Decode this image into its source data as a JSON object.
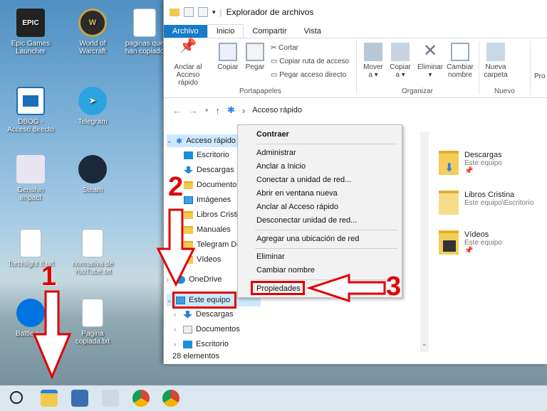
{
  "desktop": {
    "icons": [
      {
        "label": "Epic Games Launcher",
        "badge": "EPIC"
      },
      {
        "label": "World of Warcraft",
        "badge": "W"
      },
      {
        "label": "paginas que han copiado",
        "badge": ""
      },
      {
        "label": "DBOG - Acceso directo",
        "badge": ""
      },
      {
        "label": "Telegram",
        "badge": ""
      },
      {
        "label": "Genshin Impact",
        "badge": ""
      },
      {
        "label": "Steam",
        "badge": ""
      },
      {
        "label": "Torchlight II.url",
        "badge": ""
      },
      {
        "label": "normativa de YouTube.txt",
        "badge": ""
      },
      {
        "label": "Battle.net",
        "badge": ""
      },
      {
        "label": "Pagina copiada.txt",
        "badge": ""
      }
    ]
  },
  "window": {
    "title": "Explorador de archivos",
    "tabs": [
      "Archivo",
      "Inicio",
      "Compartir",
      "Vista"
    ],
    "ribbon": {
      "anclar": "Anclar al Acceso rápido",
      "copiar": "Copiar",
      "pegar": "Pegar",
      "cortar": "Cortar",
      "copiar_ruta": "Copiar ruta de acceso",
      "pegar_acceso": "Pegar acceso directo",
      "grupo_portapapeles": "Portapapeles",
      "mover": "Mover a ▾",
      "copiar_a": "Copiar a ▾",
      "eliminar": "Eliminar ▾",
      "cambiar": "Cambiar nombre",
      "grupo_organizar": "Organizar",
      "nueva": "Nueva carpeta",
      "grupo_nuevo": "Nuevo",
      "pro": "Pro"
    },
    "address": "Acceso rápido",
    "nav": [
      {
        "label": "Acceso rápido",
        "icon": "star"
      },
      {
        "label": "Escritorio",
        "icon": "blue"
      },
      {
        "label": "Descargas",
        "icon": "dl"
      },
      {
        "label": "Documentos",
        "icon": "folder"
      },
      {
        "label": "Imágenes",
        "icon": "img"
      },
      {
        "label": "Libros Cristina",
        "icon": "folder"
      },
      {
        "label": "Manuales",
        "icon": "folder"
      },
      {
        "label": "Telegram Desktop",
        "icon": "folder"
      },
      {
        "label": "Vídeos",
        "icon": "folder"
      },
      {
        "label": "OneDrive",
        "icon": "blue"
      },
      {
        "label": "Este equipo",
        "icon": "pc"
      },
      {
        "label": "Descargas",
        "icon": "dl"
      },
      {
        "label": "Documentos",
        "icon": "folder"
      },
      {
        "label": "Escritorio",
        "icon": "blue"
      }
    ],
    "status": "28 elementos",
    "content": [
      {
        "name": "Descargas",
        "sub": "Este equipo",
        "pin": "📌"
      },
      {
        "name": "Libros Cristina",
        "sub": "Este equipo\\Escritorio"
      },
      {
        "name": "Vídeos",
        "sub": "Este equipo",
        "pin": "📌"
      }
    ]
  },
  "context_menu": {
    "header": "Contraer",
    "group1": [
      "Administrar",
      "Anclar a Inicio",
      "Conectar a unidad de red...",
      "Abrir en ventana nueva",
      "Anclar al Acceso rápido",
      "Desconectar unidad de red..."
    ],
    "group2": [
      "Agregar una ubicación de red"
    ],
    "group3": [
      "Eliminar",
      "Cambiar nombre"
    ],
    "group4": [
      "Propiedades"
    ]
  },
  "annotations": {
    "n1": "1",
    "n2": "2",
    "n3": "3"
  },
  "colors": {
    "accent": "#1979ca",
    "annotation": "#e00000"
  }
}
